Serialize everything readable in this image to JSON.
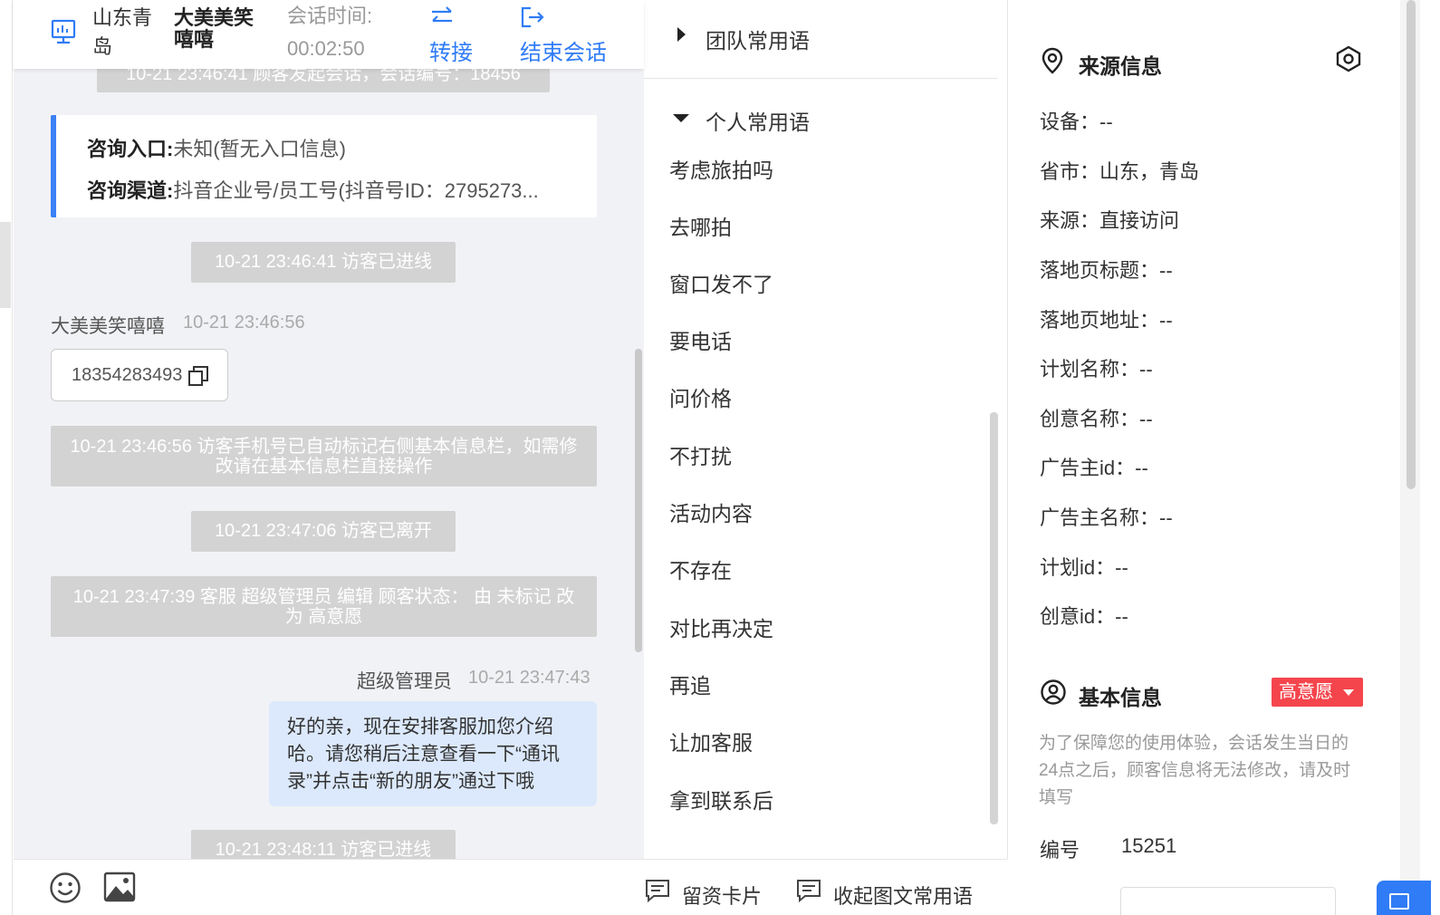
{
  "header": {
    "location": "山东青岛",
    "customer_name": "大美美笑嘻嘻",
    "session_time_label": "会话时间:",
    "session_time": "00:02:50",
    "transfer_label": "转接",
    "end_session_label": "结束会话"
  },
  "chat": {
    "messages_system": [
      "10-21 23:46:41 顾客发起会话，会话编号：18456",
      "10-21 23:46:41 访客已进线",
      "10-21 23:46:56 访客手机号已自动标记右侧基本信息栏，如需修改请在基本信息栏直接操作",
      "10-21 23:47:06 访客已离开",
      "10-21 23:47:39 客服 超级管理员 编辑 顾客状态： 由 未标记 改为 高意愿",
      "10-21 23:48:11 访客已进线"
    ],
    "consult": {
      "entry_label": "咨询入口:",
      "entry_value": "未知(暂无入口信息)",
      "channel_label": "咨询渠道:",
      "channel_value": "抖音企业号/员工号(抖音号ID：2795273..."
    },
    "visitor": {
      "name": "大美美笑嘻嘻",
      "time": "10-21 23:46:56",
      "message": "18354283493"
    },
    "agent": {
      "name": "超级管理员",
      "time": "10-21 23:47:43",
      "message": "好的亲，现在安排客服加您介绍哈。请您稍后注意查看一下“通讯录”并点击“新的朋友”通过下哦"
    }
  },
  "toolbar": {
    "icons": [
      "emoji-icon",
      "image-icon"
    ],
    "info_card_label": "留资卡片",
    "collapse_label": "收起图文常用语"
  },
  "phrases": {
    "team_group": "团队常用语",
    "personal_group": "个人常用语",
    "items": [
      "考虑旅拍吗",
      "去哪拍",
      "窗口发不了",
      "要电话",
      "问价格",
      "不打扰",
      "活动内容",
      "不存在",
      "对比再决定",
      "再追",
      "让加客服",
      "拿到联系后"
    ]
  },
  "info": {
    "source_title": "来源信息",
    "source_rows": [
      "设备：--",
      "省市：山东，青岛",
      "来源：直接访问",
      "落地页标题：--",
      "落地页地址：--",
      "计划名称：--",
      "创意名称：--",
      "广告主id：--",
      "广告主名称：--",
      "计划id：--",
      "创意id：--"
    ],
    "basic_title": "基本信息",
    "status": "高意愿",
    "notice": "为了保障您的使用体验，会话发生当日的24点之后，顾客信息将无法修改，请及时填写",
    "id_label": "编号",
    "id_value": "15251"
  },
  "colors": {
    "accent": "#2f7cf6",
    "status": "#f5454c",
    "agent_bubble": "#dce9fc",
    "system_msg": "#d3d3d3"
  }
}
